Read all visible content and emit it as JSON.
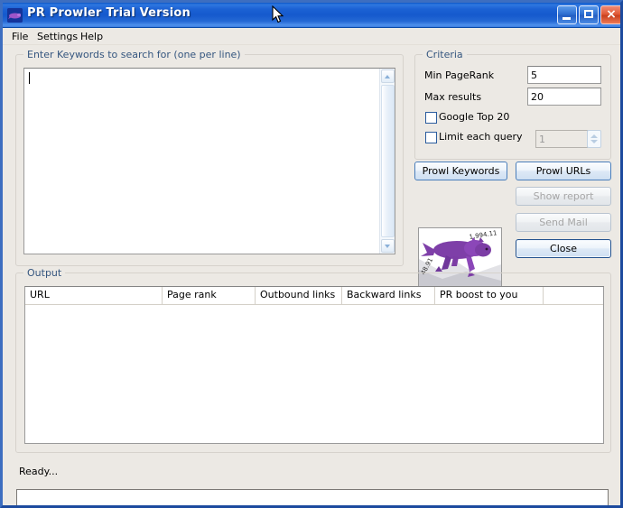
{
  "window": {
    "title": "PR Prowler Trial Version",
    "icon": "prowler-panther-icon",
    "minimize_label": "Minimize",
    "maximize_label": "Maximize",
    "close_label": "×",
    "accent_color": "#1559cd",
    "background_color": "#ece9e4"
  },
  "menu": {
    "items": [
      {
        "label": "File"
      },
      {
        "label": "Settings"
      },
      {
        "label": "Help"
      }
    ]
  },
  "keywords": {
    "group_label": "Enter Keywords to search for (one per line)",
    "value": "",
    "placeholder": ""
  },
  "criteria": {
    "group_label": "Criteria",
    "min_pagerank_label": "Min PageRank",
    "min_pagerank_value": "5",
    "max_results_label": "Max results",
    "max_results_value": "20",
    "google_top_20_label": "Google Top 20",
    "google_top_20_checked": false,
    "limit_each_query_label": "Limit each query",
    "limit_each_query_checked": false,
    "limit_each_query_value": "1"
  },
  "actions": {
    "prowl_keywords_label": "Prowl Keywords",
    "prowl_urls_label": "Prowl URLs",
    "show_report_label": "Show report",
    "show_report_enabled": false,
    "send_mail_label": "Send Mail",
    "send_mail_enabled": false,
    "close_label": "Close",
    "dots": ". . . . . . . . . . . . . . . . . ."
  },
  "output": {
    "group_label": "Output",
    "columns": [
      {
        "label": "URL",
        "width": 152
      },
      {
        "label": "Page rank",
        "width": 103
      },
      {
        "label": "Outbound links",
        "width": 96
      },
      {
        "label": "Backward links",
        "width": 103
      },
      {
        "label": "PR boost to you",
        "width": 120
      },
      {
        "label": "",
        "width": 66
      }
    ],
    "rows": []
  },
  "statusbar": {
    "text": "Ready...",
    "progress_percent": 0
  }
}
